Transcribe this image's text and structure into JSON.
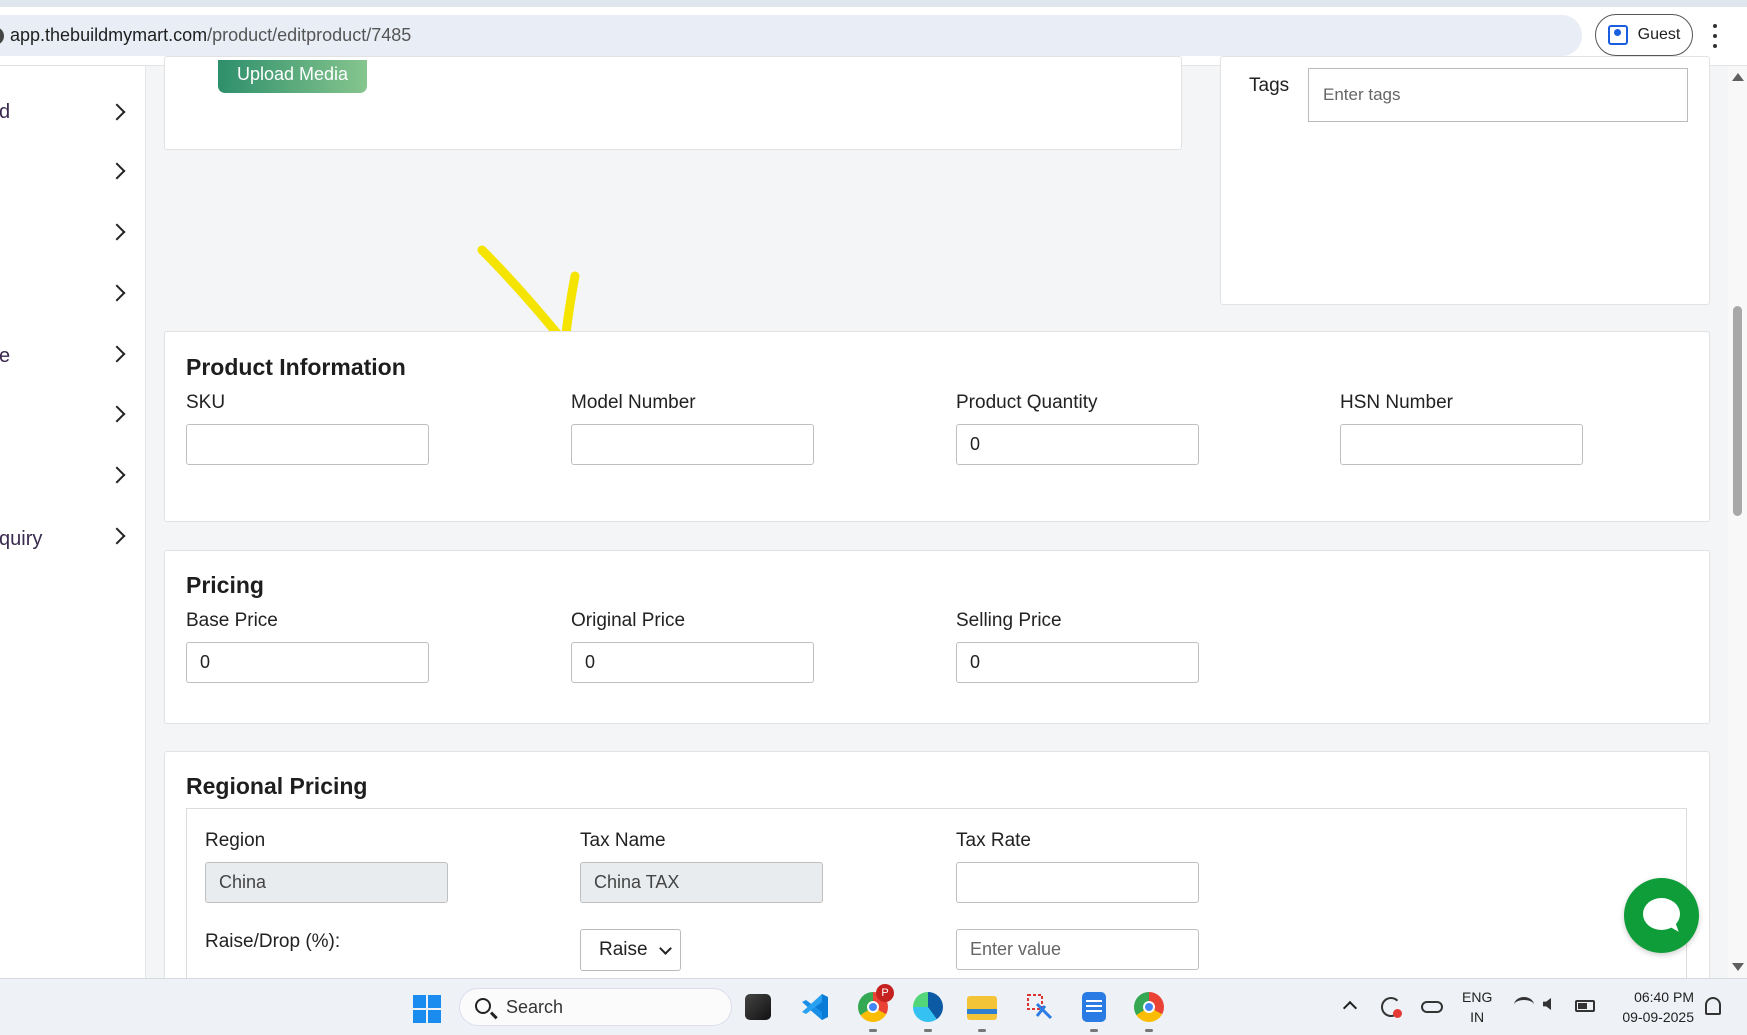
{
  "browser": {
    "url_host": "app.thebuildmymart.com",
    "url_path": "/product/editproduct/7485",
    "profile_label": "Guest"
  },
  "sidebar": {
    "items": [
      {
        "label": "d"
      },
      {
        "label": ""
      },
      {
        "label": ""
      },
      {
        "label": ""
      },
      {
        "label": "e"
      },
      {
        "label": ""
      },
      {
        "label": ""
      },
      {
        "label": "quiry"
      }
    ]
  },
  "media": {
    "upload_label": "Upload Media"
  },
  "tags": {
    "label": "Tags",
    "placeholder": "Enter tags"
  },
  "product_info": {
    "title": "Product Information",
    "fields": [
      {
        "label": "SKU",
        "value": ""
      },
      {
        "label": "Model Number",
        "value": ""
      },
      {
        "label": "Product Quantity",
        "value": "0"
      },
      {
        "label": "HSN Number",
        "value": ""
      }
    ]
  },
  "pricing": {
    "title": "Pricing",
    "fields": [
      {
        "label": "Base Price",
        "value": "0"
      },
      {
        "label": "Original Price",
        "value": "0"
      },
      {
        "label": "Selling Price",
        "value": "0"
      }
    ]
  },
  "regional_pricing": {
    "title": "Regional Pricing",
    "region_label": "Region",
    "region_value": "China",
    "tax_name_label": "Tax Name",
    "tax_name_value": "China TAX",
    "tax_rate_label": "Tax Rate",
    "tax_rate_value": "",
    "raise_drop_label": "Raise/Drop (%):",
    "raise_drop_selected": "Raise",
    "value_placeholder": "Enter value"
  },
  "annotation": {
    "arrow_color": "#f5e400"
  },
  "taskbar": {
    "search_label": "Search",
    "lang_top": "ENG",
    "lang_bottom": "IN",
    "time": "06:40 PM",
    "date": "09-09-2025",
    "chrome_badge": "P"
  },
  "colors": {
    "accent_green": "#0f9d3a",
    "upload_gradient_start": "#2e8f6b",
    "upload_gradient_end": "#86c58e"
  }
}
